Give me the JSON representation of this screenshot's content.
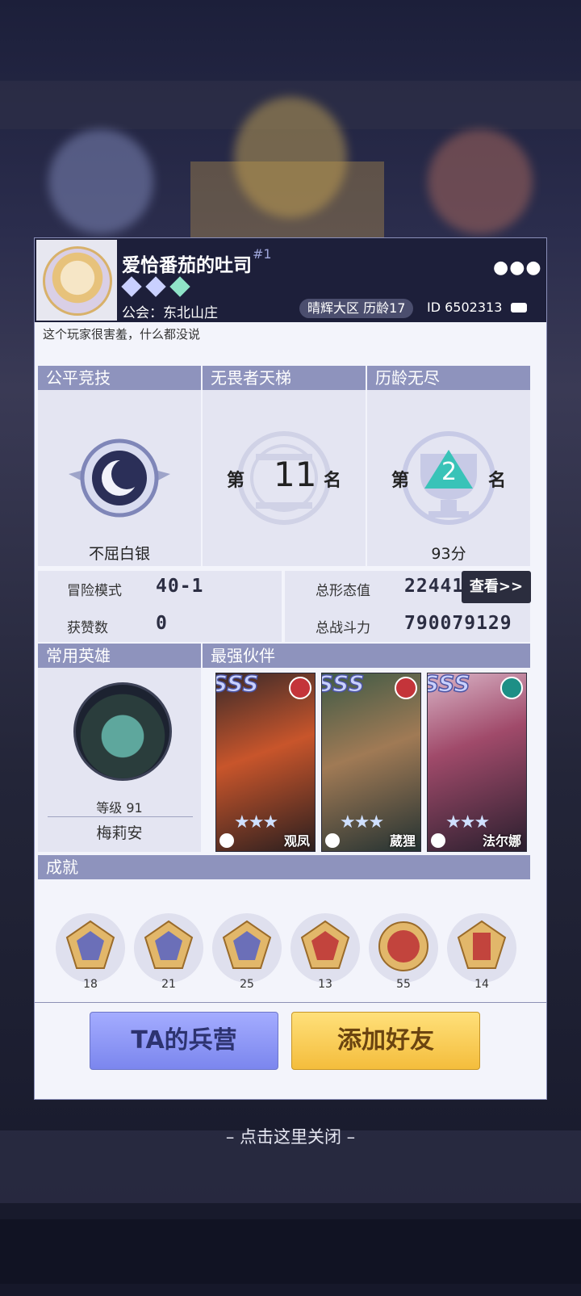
{
  "player": {
    "name": "爱恰番茄的吐司",
    "rank_tag": "#1",
    "guild": "公会：东北山庄",
    "server": "晴辉大区  历龄17",
    "id": "ID 6502313",
    "signature": "这个玩家很害羞，什么都没说",
    "more": "●●●"
  },
  "pvp": [
    {
      "title": "公平竞技",
      "label": "不屈白银"
    },
    {
      "title": "无畏者天梯",
      "rank_prefix": "第",
      "rank": "11",
      "rank_suffix": "名"
    },
    {
      "title": "历龄无尽",
      "rank_prefix": "第",
      "rank": "2",
      "rank_suffix": "名",
      "label": "93分"
    }
  ],
  "stats": {
    "adventure_label": "冒险模式",
    "adventure_value": "40-1",
    "likes_label": "获赞数",
    "likes_value": "0",
    "form_label": "总形态值",
    "form_value": "22441",
    "power_label": "总战斗力",
    "power_value": "790079129",
    "view_button": "查看>>"
  },
  "common_hero": {
    "header": "常用英雄",
    "level": "等级 91",
    "name": "梅莉安"
  },
  "partners": {
    "header": "最强伙伴",
    "items": [
      {
        "grade": "SSS",
        "name": "观凤",
        "stars": "★★★",
        "elem_color": "#c4343a",
        "art": "#c8552b"
      },
      {
        "grade": "SSS",
        "name": "葳狸",
        "stars": "★★★",
        "elem_color": "#c4343a",
        "art": "#7a8a52"
      },
      {
        "grade": "SSS",
        "name": "法尔娜",
        "stars": "★★★",
        "elem_color": "#1d8f86",
        "art": "#a04a6a"
      }
    ]
  },
  "achievements": {
    "header": "成就",
    "items": [
      {
        "count": "18",
        "color": "#6b6fb8"
      },
      {
        "count": "21",
        "color": "#6b6fb8"
      },
      {
        "count": "25",
        "color": "#6b6fb8"
      },
      {
        "count": "13",
        "color": "#c2443d"
      },
      {
        "count": "55",
        "color": "#c2443d"
      },
      {
        "count": "14",
        "color": "#c2443d"
      }
    ]
  },
  "buttons": {
    "camp": "TA的兵营",
    "add_friend": "添加好友"
  },
  "close_hint": "– 点击这里关闭 –"
}
